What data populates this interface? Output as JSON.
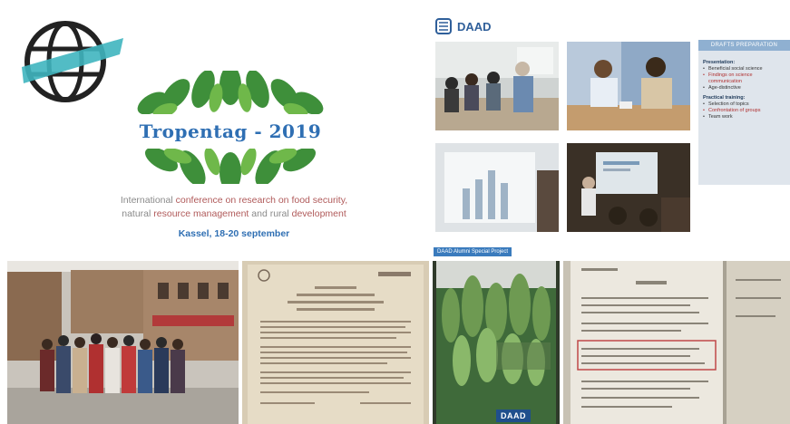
{
  "tropentag": {
    "title": "Tropentag - 2019",
    "subtitle_line1_a": "International ",
    "subtitle_line1_b": "conference on research on food security,",
    "subtitle_line2_a": "natural ",
    "subtitle_line2_b": "resource management",
    "subtitle_line2_c": " and rural ",
    "subtitle_line2_d": "development",
    "dates": "Kassel, 18-20 september"
  },
  "daad_slide": {
    "logo_text": "DAAD",
    "sidebar_header": "DRAFTS PREPARATION",
    "sidebar_sections": [
      {
        "heading": "Presentation:",
        "items": [
          {
            "text": "Beneficial social science",
            "red": false
          },
          {
            "text": "Findings on science communication",
            "red": true
          },
          {
            "text": "Age-distinctive",
            "red": false
          }
        ]
      },
      {
        "heading": "Practical training:",
        "items": [
          {
            "text": "Selection of topics",
            "red": false
          },
          {
            "text": "Confrontation of groups",
            "red": true
          },
          {
            "text": "Team work",
            "red": false
          }
        ]
      }
    ],
    "footer_tag": "DAAD Alumni Special Project"
  },
  "poster": {
    "badge": "DAAD"
  },
  "colors": {
    "brand_blue": "#2f6fb3",
    "daad_blue": "#1f4f8c",
    "teal_stripe": "#3fb5bf"
  }
}
